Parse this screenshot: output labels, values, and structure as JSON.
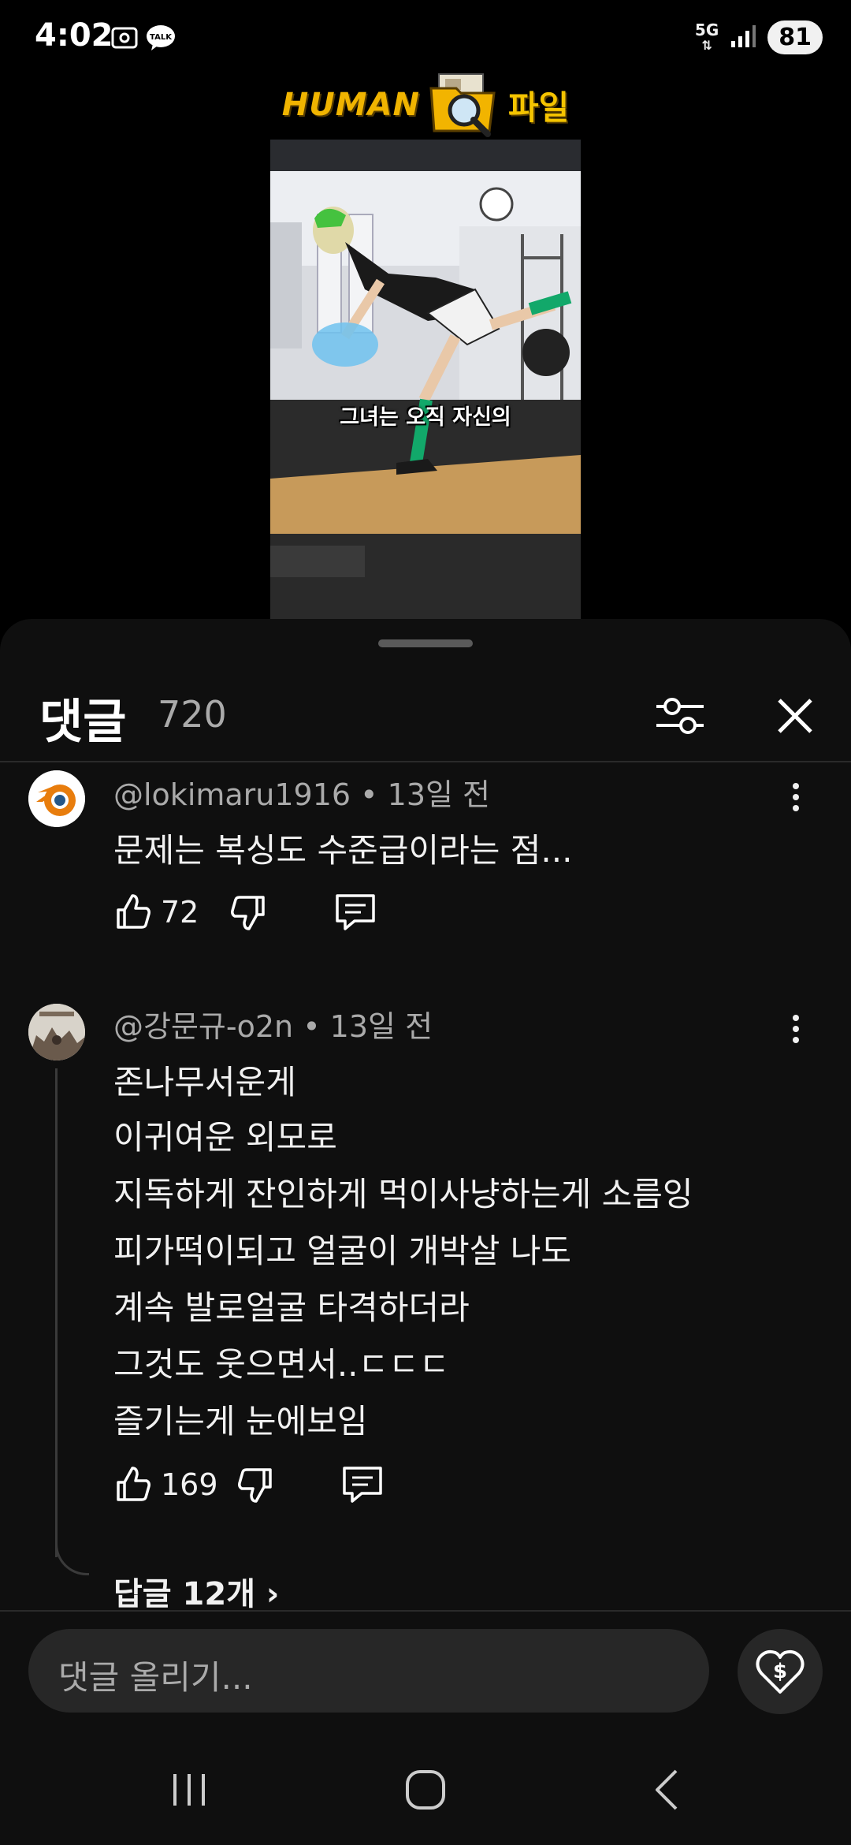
{
  "status_bar": {
    "time": "4:02",
    "talk_label": "TALK",
    "network": "5G",
    "battery": "81"
  },
  "banner": {
    "left_text": "HUMAN",
    "right_text": "파일"
  },
  "video": {
    "caption": "그녀는 오직 자신의"
  },
  "comments_header": {
    "title": "댓글",
    "count": "720"
  },
  "comments": [
    {
      "author": "@lokimaru1916",
      "time": " • 13일 전",
      "lines": [
        "문제는 복싱도 수준급이라는 점..."
      ],
      "likes": "72"
    },
    {
      "author": "@강문규-o2n",
      "time": " • 13일 전",
      "lines": [
        "존나무서운게",
        "이귀여운 외모로",
        "지독하게 잔인하게 먹이사냥하는게 소름잉",
        "피가떡이되고 얼굴이 개박살 나도",
        "계속 발로얼굴 타격하더라",
        "그것도 웃으면서..ㄷㄷㄷ",
        "즐기는게 눈에보임"
      ],
      "likes": "169",
      "replies_label": "답글 12개 ›"
    }
  ],
  "composer": {
    "placeholder": "댓글 올리기..."
  },
  "colors": {
    "background": "#000000",
    "sheet": "#0f0f0f",
    "input": "#272727",
    "banner_gold": "#f0b400"
  },
  "icons": {
    "sort": "sliders-icon",
    "close": "close-icon",
    "like": "thumbs-up-icon",
    "dislike": "thumbs-down-icon",
    "reply": "reply-icon",
    "super_thanks": "heart-dollar-icon"
  }
}
